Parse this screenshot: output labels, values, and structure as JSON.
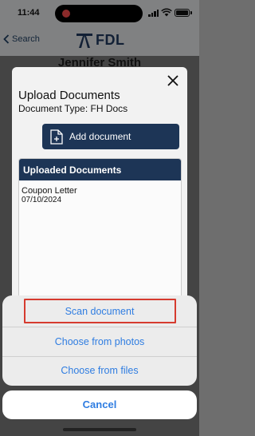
{
  "status_bar": {
    "time": "11:44"
  },
  "nav": {
    "back_label": "Search",
    "logo_text": "FDL"
  },
  "background": {
    "name": "Jennifer Smith"
  },
  "modal": {
    "title": "Upload Documents",
    "subtitle": "Document Type: FH Docs",
    "add_button_label": "Add document",
    "uploaded_header": "Uploaded Documents",
    "documents": [
      {
        "name": "Coupon Letter",
        "date": "07/10/2024"
      }
    ]
  },
  "action_sheet": {
    "items": [
      {
        "label": "Scan document"
      },
      {
        "label": "Choose from photos"
      },
      {
        "label": "Choose from files"
      }
    ],
    "cancel_label": "Cancel"
  },
  "colors": {
    "navy": "#1d3556",
    "ios_blue": "#2f7de1",
    "highlight_red": "#d63b2f"
  }
}
